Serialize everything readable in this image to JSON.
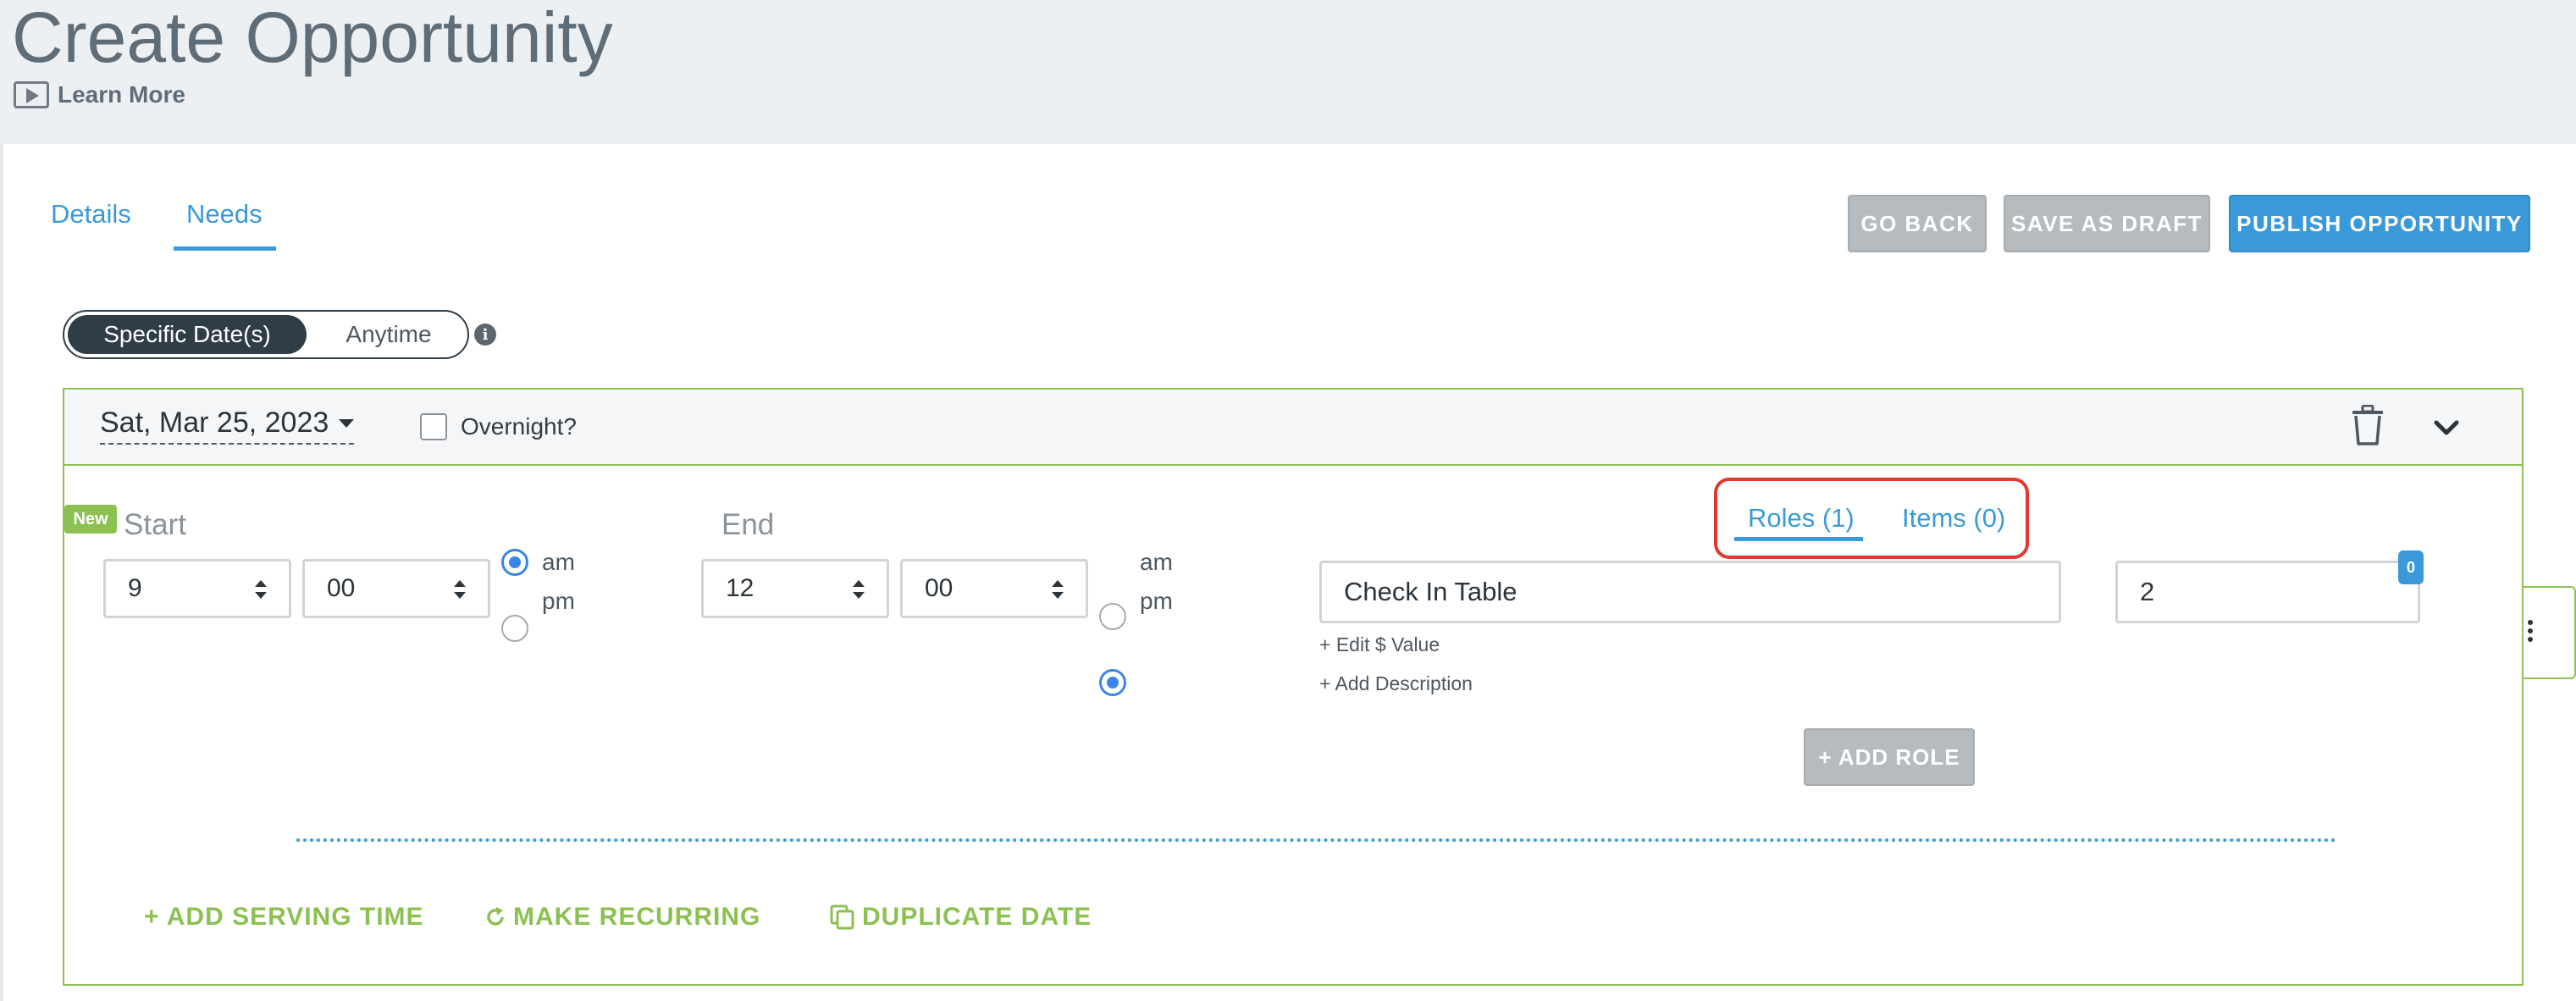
{
  "header": {
    "title": "Create Opportunity",
    "learn_more": "Learn More"
  },
  "tabs": {
    "details": "Details",
    "needs": "Needs",
    "active": "Needs"
  },
  "actions": {
    "go_back": "GO BACK",
    "save_draft": "SAVE AS DRAFT",
    "publish": "PUBLISH OPPORTUNITY"
  },
  "schedule_toggle": {
    "specific": "Specific Date(s)",
    "anytime": "Anytime",
    "selected": "Specific Date(s)"
  },
  "date_card": {
    "date": "Sat, Mar 25, 2023",
    "overnight_label": "Overnight?",
    "overnight_checked": false
  },
  "serving_time": {
    "new_badge": "New",
    "start_label": "Start",
    "end_label": "End",
    "start_hour": "9",
    "start_minute": "00",
    "start_meridiem": "am",
    "end_hour": "12",
    "end_minute": "00",
    "end_meridiem": "pm",
    "am_label": "am",
    "pm_label": "pm"
  },
  "needs_tabs": {
    "roles": "Roles (1)",
    "items": "Items (0)",
    "active": "Roles (1)"
  },
  "role": {
    "name": "Check In Table",
    "quantity": "2",
    "filled_badge": "0",
    "edit_value_link": "+ Edit $ Value",
    "add_description_link": "+ Add Description",
    "add_role_button": "+ ADD ROLE"
  },
  "footer": {
    "add_serving_time": "+ ADD SERVING TIME",
    "make_recurring": "MAKE RECURRING",
    "duplicate_date": "DUPLICATE DATE"
  },
  "colors": {
    "accent_blue": "#3a9ad9",
    "accent_green": "#8cc152",
    "highlight_red": "#e0392f",
    "button_grey": "#b6bbbf",
    "header_bg": "#edf0f3"
  },
  "icons": [
    "play-icon",
    "info-icon",
    "caret-down-icon",
    "trash-icon",
    "chevron-down-icon",
    "updown-caret-icon",
    "kebab-icon",
    "refresh-icon",
    "copy-icon"
  ]
}
